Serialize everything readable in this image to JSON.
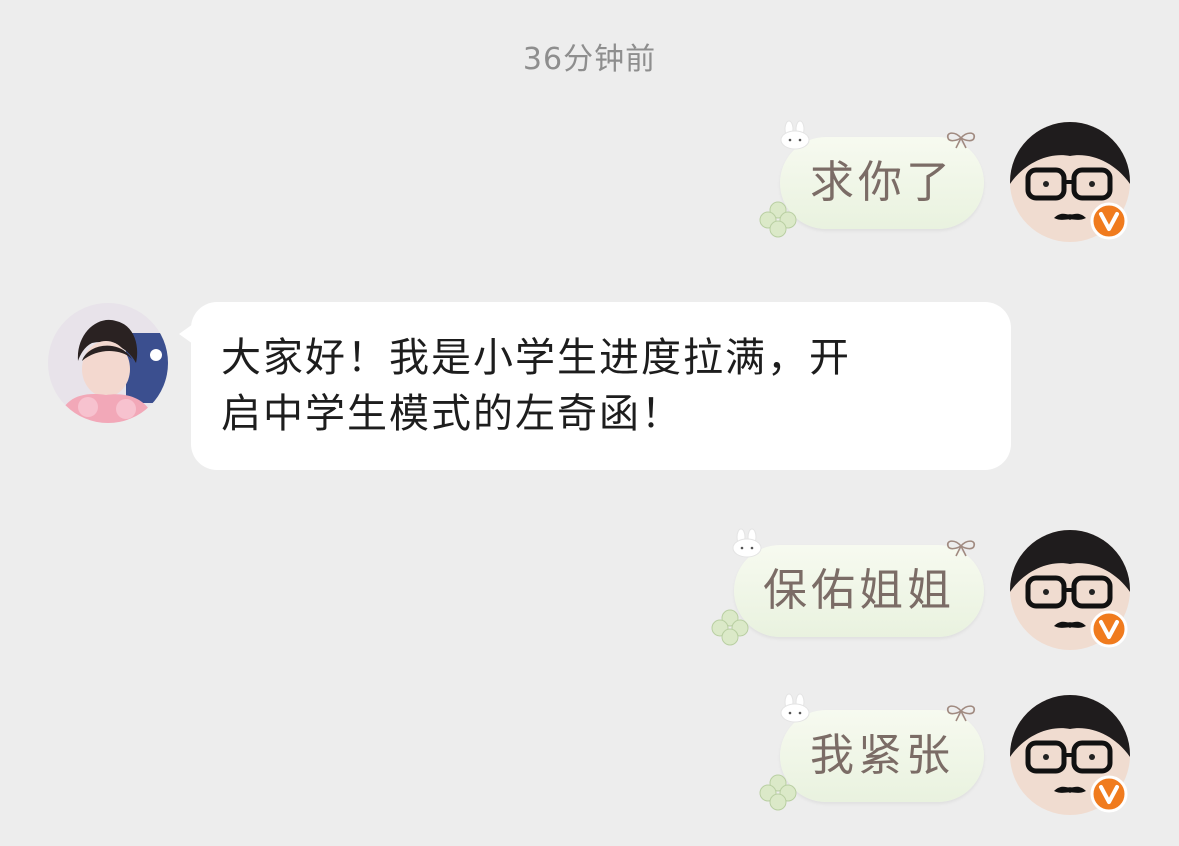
{
  "timestamp": "36分钟前",
  "messages": [
    {
      "side": "right",
      "text": "求你了",
      "avatar": "self-avatar-glasses-mustache",
      "badge": "V"
    },
    {
      "side": "left",
      "text_lines": [
        "大家好！我是小学生进度拉满，开",
        "启中学生模式的左奇函！"
      ],
      "avatar": "contact-avatar-photo"
    },
    {
      "side": "right",
      "text": "保佑姐姐",
      "avatar": "self-avatar-glasses-mustache",
      "badge": "V"
    },
    {
      "side": "right",
      "text": "我紧张",
      "avatar": "self-avatar-glasses-mustache",
      "badge": "V"
    }
  ],
  "colors": {
    "background": "#ededed",
    "incoming_bubble": "#ffffff",
    "outgoing_bubble": "#eef5e6",
    "outgoing_text": "#7b6c66",
    "badge": "#f07b1e"
  },
  "icons": [
    "bunny-icon",
    "bow-icon",
    "clover-icon",
    "verified-v-badge-icon"
  ]
}
